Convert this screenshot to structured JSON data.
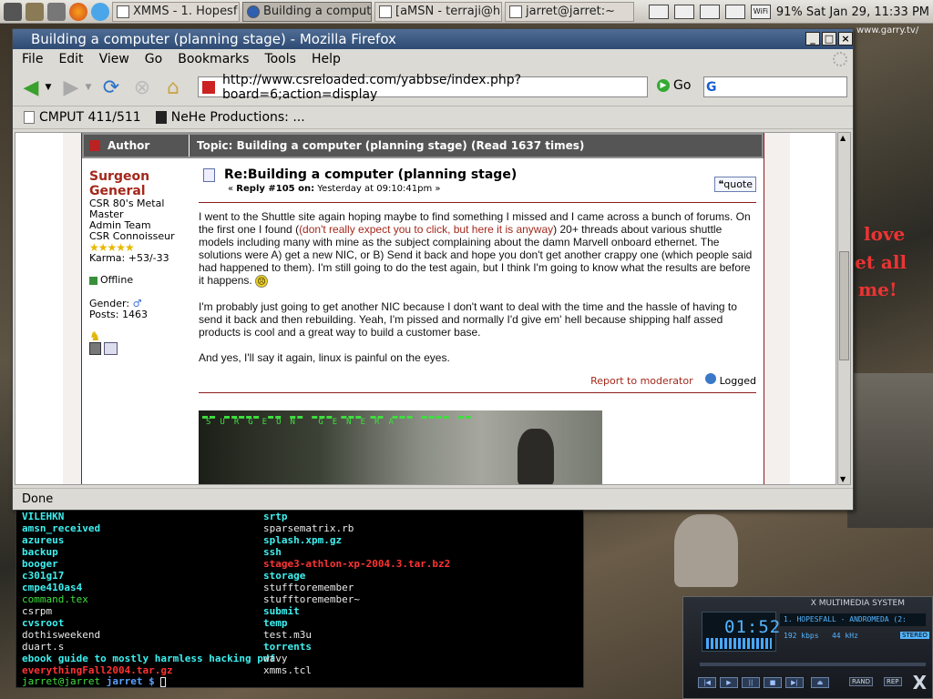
{
  "panel": {
    "tasks": [
      {
        "label": "XMMS - 1. Hopesf",
        "active": false
      },
      {
        "label": "Building a compute",
        "active": true
      },
      {
        "label": "[aMSN - terraji@ho",
        "active": false
      },
      {
        "label": "jarret@jarret:~",
        "active": false
      }
    ],
    "clock": "91% Sat Jan 29, 11:33 PM"
  },
  "firefox": {
    "title": "Building a computer (planning stage) - Mozilla Firefox",
    "menu": [
      "File",
      "Edit",
      "View",
      "Go",
      "Bookmarks",
      "Tools",
      "Help"
    ],
    "url": "http://www.csreloaded.com/yabbse/index.php?board=6;action=display",
    "go_label": "Go",
    "bookmarks": [
      "CMPUT 411/511",
      "NeHe Productions: ..."
    ],
    "status": "Done"
  },
  "thread": {
    "author_header": "Author",
    "topic_header": "Topic: Building a computer (planning stage)  (Read 1637 times)",
    "user": {
      "name": "Surgeon General",
      "title": "CSR 80's Metal Master",
      "group": "Admin Team",
      "rank": "CSR Connoisseur",
      "stars": "★★★★★",
      "karma": "Karma: +53/-33",
      "status": "Offline",
      "gender": "Gender:",
      "posts": "Posts: 1463"
    },
    "post": {
      "title": "Re:Building a computer (planning stage)",
      "info_prefix": "« ",
      "reply": "Reply #105 on:",
      "date": " Yesterday at 09:10:41pm »",
      "quote_label": "quote",
      "p1a": "I went to the Shuttle site again hoping maybe to find something I missed and I came across a bunch of forums. On the first one I found (",
      "p1link": "(don't really expect you to click, but here it is anyway",
      "p1b": ") 20+ threads about various shuttle models including many with mine as the subject complaining about the damn Marvell onboard ethernet. The solutions were A) get a new NIC, or B) Send it back and hope you don't get another crappy one (which people said had happened to them). I'm still going to do the test again, but I think I'm going to know what the results are before it happens.",
      "p2": "I'm probably just going to get another NIC because I don't want to deal with the time and the hassle of having to send it back and then rebuilding. Yeah, I'm pissed and normally I'd give em' hell because shipping half assed products is cool and a great way to build a customer base.",
      "p3": "And yes, I'll say it again, linux is painful on the eyes.",
      "report": "Report to moderator",
      "logged": "Logged",
      "sig_text": "SURGEON GENERA"
    }
  },
  "terminal": {
    "col1": [
      {
        "t": "VILEHKN",
        "c": "cyan"
      },
      {
        "t": "amsn_received",
        "c": "cyan"
      },
      {
        "t": "azureus",
        "c": "cyan"
      },
      {
        "t": "backup",
        "c": "cyan"
      },
      {
        "t": "booger",
        "c": "cyan"
      },
      {
        "t": "c301g17",
        "c": "cyan"
      },
      {
        "t": "cmpe410as4",
        "c": "cyan"
      },
      {
        "t": "command.tex",
        "c": "green"
      },
      {
        "t": "csrpm",
        "c": "white"
      },
      {
        "t": "cvsroot",
        "c": "cyan"
      },
      {
        "t": "dothisweekend",
        "c": "white"
      },
      {
        "t": "duart.s",
        "c": "white"
      },
      {
        "t": "ebook guide to mostly harmless hacking pdf",
        "c": "cyan"
      },
      {
        "t": "everythingFall2004.tar.gz",
        "c": "red"
      }
    ],
    "col2": [
      {
        "t": "srtp",
        "c": "cyan"
      },
      {
        "t": "sparsematrix.rb",
        "c": "white"
      },
      {
        "t": "splash.xpm.gz",
        "c": "cyan"
      },
      {
        "t": "ssh",
        "c": "cyan"
      },
      {
        "t": "stage3-athlon-xp-2004.3.tar.bz2",
        "c": "red"
      },
      {
        "t": "storage",
        "c": "cyan"
      },
      {
        "t": "stufftoremember",
        "c": "white"
      },
      {
        "t": "stufftoremember~",
        "c": "white"
      },
      {
        "t": "submit",
        "c": "cyan"
      },
      {
        "t": "temp",
        "c": "cyan"
      },
      {
        "t": "test.m3u",
        "c": "white"
      },
      {
        "t": "torrents",
        "c": "cyan"
      },
      {
        "t": "wavy",
        "c": "white"
      },
      {
        "t": "xmms.tcl",
        "c": "white"
      }
    ],
    "prompt_user": "jarret@jarret",
    "prompt_dir": " jarret $ "
  },
  "xmms": {
    "title": "X MULTIMEDIA SYSTEM",
    "time": "01:52",
    "song": "1. HOPESFALL - ANDROMEDA (2:",
    "kbps": "192 kbps",
    "khz": "44 kHz",
    "stereo": "STEREO",
    "rand": "RAND",
    "rep": "REP"
  },
  "desktop": {
    "url_text": "www.garry.tv/",
    "love1": "love",
    "love2": "et all",
    "love3": "me!"
  },
  "colors": {
    "brand_red": "#a4281b",
    "titlebar": "#2d4a72",
    "term_cyan": "#3df0f0"
  }
}
